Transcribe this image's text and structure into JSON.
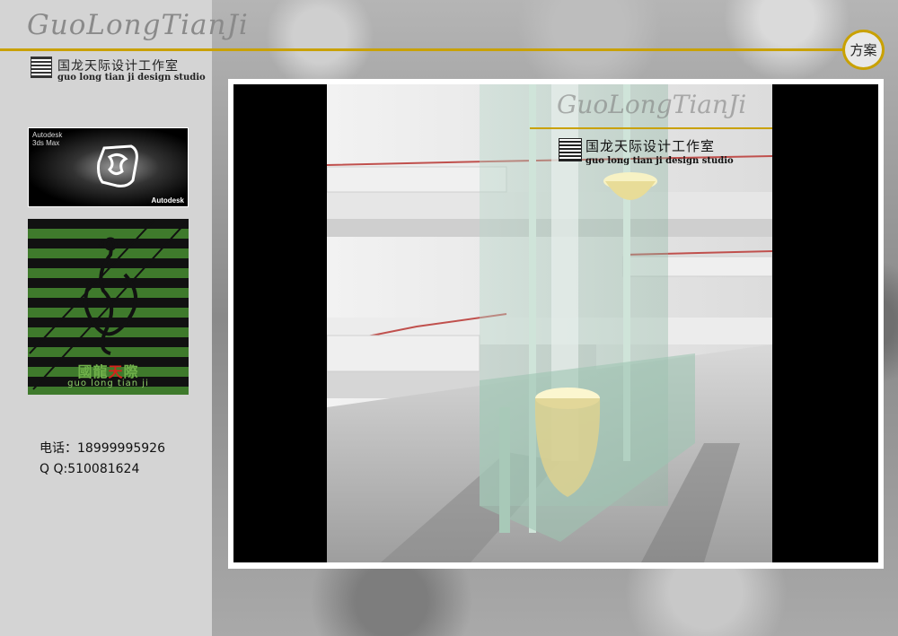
{
  "header": {
    "brand_script": "GuoLongTianJi",
    "plan_label": "方案"
  },
  "studio": {
    "name_cn": "国龙天际设计工作室",
    "name_en": "guo long tian ji design studio"
  },
  "software_badge": {
    "title_line1": "Autodesk",
    "title_line2": "3ds Max",
    "brand": "Autodesk"
  },
  "logo_panel": {
    "name_cn_a": "國龍",
    "name_cn_b": "天",
    "name_cn_c": "際",
    "name_en": "guo long tian ji"
  },
  "contact": {
    "phone": "电话：18999995926",
    "qq": "Q  Q:510081624"
  },
  "watermark": {
    "brand_script": "GuoLongTianJi",
    "name_cn": "国龙天际设计工作室",
    "name_en": "guo long tian ji design studio"
  },
  "colors": {
    "accent_gold": "#c9a100",
    "stripe_green": "#3f7a2c",
    "sidebar_bg": "#d4d4d4"
  }
}
